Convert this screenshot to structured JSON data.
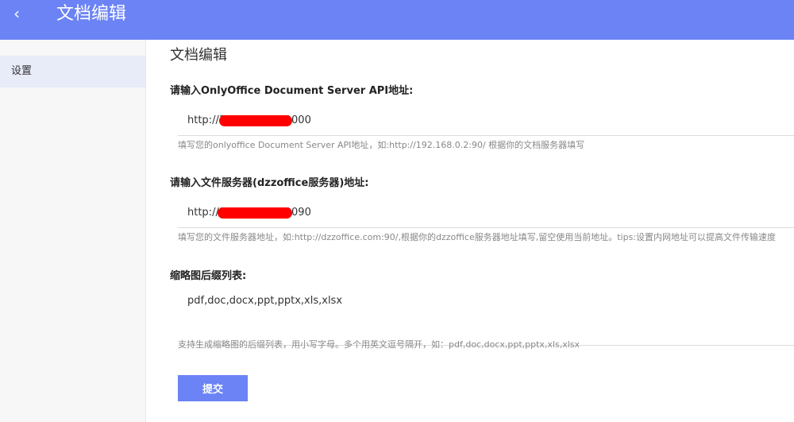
{
  "header": {
    "back_icon": "‹",
    "title": "文档编辑"
  },
  "sidebar": {
    "items": [
      {
        "label": "设置"
      }
    ]
  },
  "main": {
    "title": "文档编辑",
    "fields": [
      {
        "label": "请输入OnlyOffice Document Server API地址:",
        "value": "http://192.168.0.2:9000",
        "help": "填写您的onlyoffice Document Server API地址，如:http://192.168.0.2:90/ 根据你的文档服务器填写"
      },
      {
        "label": "请输入文件服务器(dzzoffice服务器)地址:",
        "value": "http://192.168.0.2:9090",
        "help": "填写您的文件服务器地址，如:http://dzzoffice.com:90/,根据你的dzzoffice服务器地址填写,留空使用当前地址。tips:设置内网地址可以提高文件传输速度"
      },
      {
        "label": "缩略图后缀列表:",
        "value": "pdf,doc,docx,ppt,pptx,xls,xlsx",
        "help": "支持生成缩略图的后缀列表，用小写字母。多个用英文逗号隔开，如：pdf,doc,docx,ppt,pptx,xls,xlsx"
      }
    ],
    "submit_label": "提交"
  },
  "colors": {
    "accent": "#6b83f5",
    "redaction": "#ff0000"
  }
}
